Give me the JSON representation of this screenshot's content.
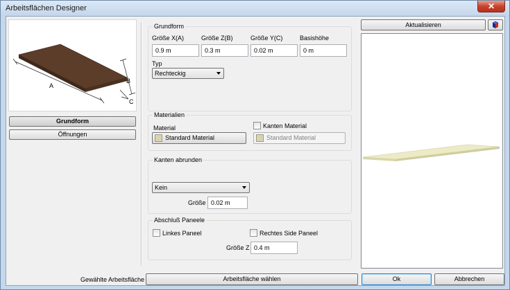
{
  "window": {
    "title": "Arbeitsflächen Designer",
    "close_glyph": "✕"
  },
  "left": {
    "diagram_labels": {
      "a": "A",
      "b": "B",
      "c": "C"
    },
    "tabs": [
      {
        "label": "Grundform",
        "selected": true
      },
      {
        "label": "Öffnungen",
        "selected": false
      }
    ]
  },
  "grundform": {
    "title": "Grundform",
    "fields": [
      {
        "label": "Größe X(A)",
        "value": "0.9 m"
      },
      {
        "label": "Größe Z(B)",
        "value": "0.3 m"
      },
      {
        "label": "Größe Y(C)",
        "value": "0.02 m"
      },
      {
        "label": "Basishöhe",
        "value": "0 m"
      }
    ],
    "typ_label": "Typ",
    "typ_value": "Rechteckig"
  },
  "materialien": {
    "title": "Materialien",
    "material_label": "Material",
    "material_value": "Standard Material",
    "kanten_label": "Kanten Material",
    "kanten_checked": false,
    "kanten_value": "Standard Material"
  },
  "kanten_abrunden": {
    "title": "Kanten abrunden",
    "type_value": "Kein",
    "size_label": "Größe",
    "size_value": "0.02 m"
  },
  "abschluss": {
    "title": "Abschluß Paneele",
    "left_label": "Linkes Paneel",
    "left_checked": false,
    "right_label": "Rechtes Side Paneel",
    "right_checked": false,
    "size_label": "Größe Z",
    "size_value": "0.4 m"
  },
  "preview": {
    "refresh_label": "Aktualisieren",
    "cube_icon": "cube-icon"
  },
  "footer": {
    "selected_label": "Gewählte Arbeitsfläche",
    "choose_label": "Arbeitsfläche wählen",
    "ok_label": "Ok",
    "cancel_label": "Abbrechen"
  },
  "colors": {
    "slab_top": "#5c3d2a",
    "slab_side": "#3e2819",
    "preview_slab": "#ecebc4"
  }
}
